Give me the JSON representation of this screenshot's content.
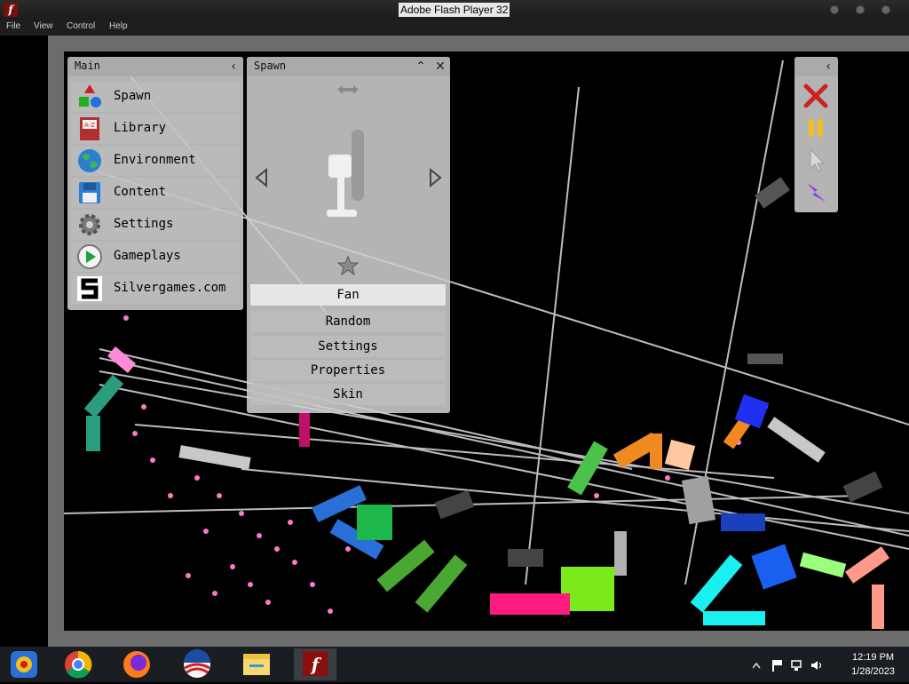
{
  "window": {
    "title": "Adobe Flash Player 32"
  },
  "menu": [
    "File",
    "View",
    "Control",
    "Help"
  ],
  "main_panel": {
    "title": "Main",
    "items": [
      {
        "label": "Spawn",
        "icon": "shapes-icon"
      },
      {
        "label": "Library",
        "icon": "book-icon"
      },
      {
        "label": "Environment",
        "icon": "globe-icon"
      },
      {
        "label": "Content",
        "icon": "floppy-disk-icon"
      },
      {
        "label": "Settings",
        "icon": "gear-icon"
      },
      {
        "label": "Gameplays",
        "icon": "play-icon"
      },
      {
        "label": "Silvergames.com",
        "icon": "silvergames-logo-icon"
      }
    ]
  },
  "spawn_panel": {
    "title": "Spawn",
    "selected_item": "Fan",
    "buttons": [
      "Random",
      "Settings",
      "Properties",
      "Skin"
    ]
  },
  "tool_panel": {
    "tools": [
      "delete-x-icon",
      "pause-icon",
      "cursor-icon",
      "lightning-icon"
    ]
  },
  "taskbar": {
    "apps": [
      "app-icon",
      "chrome-icon",
      "firefox-icon",
      "obama-logo-icon",
      "file-explorer-icon",
      "flash-player-icon"
    ],
    "time": "12:19 PM",
    "date": "1/28/2023"
  },
  "colors": {
    "panel_bg": "#cdcdcd",
    "stage_bg": "#000000",
    "accent_red": "#cc2222",
    "accent_yellow": "#f0c020",
    "accent_purple": "#8a3df0"
  }
}
